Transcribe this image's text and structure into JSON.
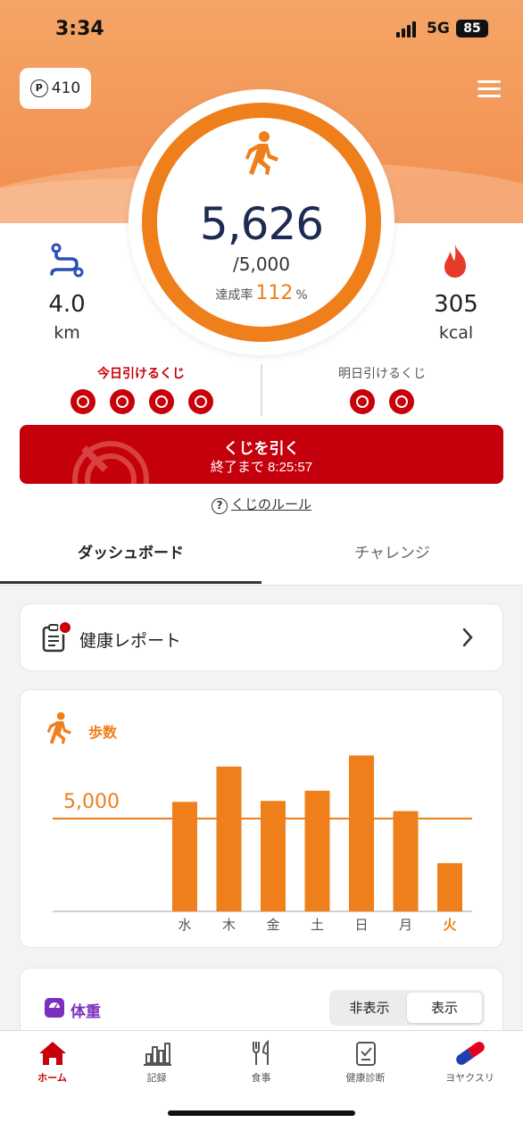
{
  "status_bar": {
    "time": "3:34",
    "network": "5G",
    "battery": "85"
  },
  "header": {
    "points": "410",
    "points_symbol": "P",
    "menu_icon": "hamburger-menu-icon"
  },
  "activity": {
    "steps": "5,626",
    "goal": "/5,000",
    "achievement_label": "達成率",
    "achievement_value": "112",
    "achievement_unit": "%",
    "distance_value": "4.0",
    "distance_unit": "km",
    "calories_value": "305",
    "calories_unit": "kcal"
  },
  "lottery": {
    "today_label": "今日引けるくじ",
    "today_count": 4,
    "tomorrow_label": "明日引けるくじ",
    "tomorrow_count": 2,
    "button_label": "くじを引く",
    "button_sub": "終了まで 8:25:57",
    "rules_link": "くじのルール",
    "rules_icon": "?"
  },
  "tabs": [
    {
      "label": "ダッシュボード",
      "active": true
    },
    {
      "label": "チャレンジ",
      "active": false
    }
  ],
  "health_report": {
    "label": "健康レポート"
  },
  "steps_card": {
    "title": "歩数"
  },
  "chart_data": {
    "type": "bar",
    "categories": [
      "水",
      "木",
      "金",
      "土",
      "日",
      "月",
      "火"
    ],
    "values": [
      5900,
      7800,
      5950,
      6500,
      8400,
      5400,
      2600
    ],
    "highlight_category": "火",
    "reference_line": 5000,
    "reference_label": "5,000",
    "title": "歩数",
    "xlabel": "",
    "ylabel": "",
    "ylim": [
      0,
      10000
    ],
    "bar_color": "#ee7f1a",
    "highlight_color": "#ee7f1a"
  },
  "weight_card": {
    "title": "体重",
    "toggle": [
      {
        "label": "非表示",
        "selected": false
      },
      {
        "label": "表示",
        "selected": true
      }
    ]
  },
  "bottom_nav": [
    {
      "label": "ホーム",
      "icon": "home-icon",
      "active": true
    },
    {
      "label": "記録",
      "icon": "bar-chart-icon",
      "active": false
    },
    {
      "label": "食事",
      "icon": "fork-knife-icon",
      "active": false
    },
    {
      "label": "健康診断",
      "icon": "clipboard-check-icon",
      "active": false
    },
    {
      "label": "ヨヤクスリ",
      "icon": "pill-icon",
      "active": false
    }
  ],
  "colors": {
    "accent": "#ee7f1a",
    "lottery_red": "#c4000c",
    "weight_purple": "#7b2fbf",
    "distance_blue": "#2b4fb8"
  }
}
